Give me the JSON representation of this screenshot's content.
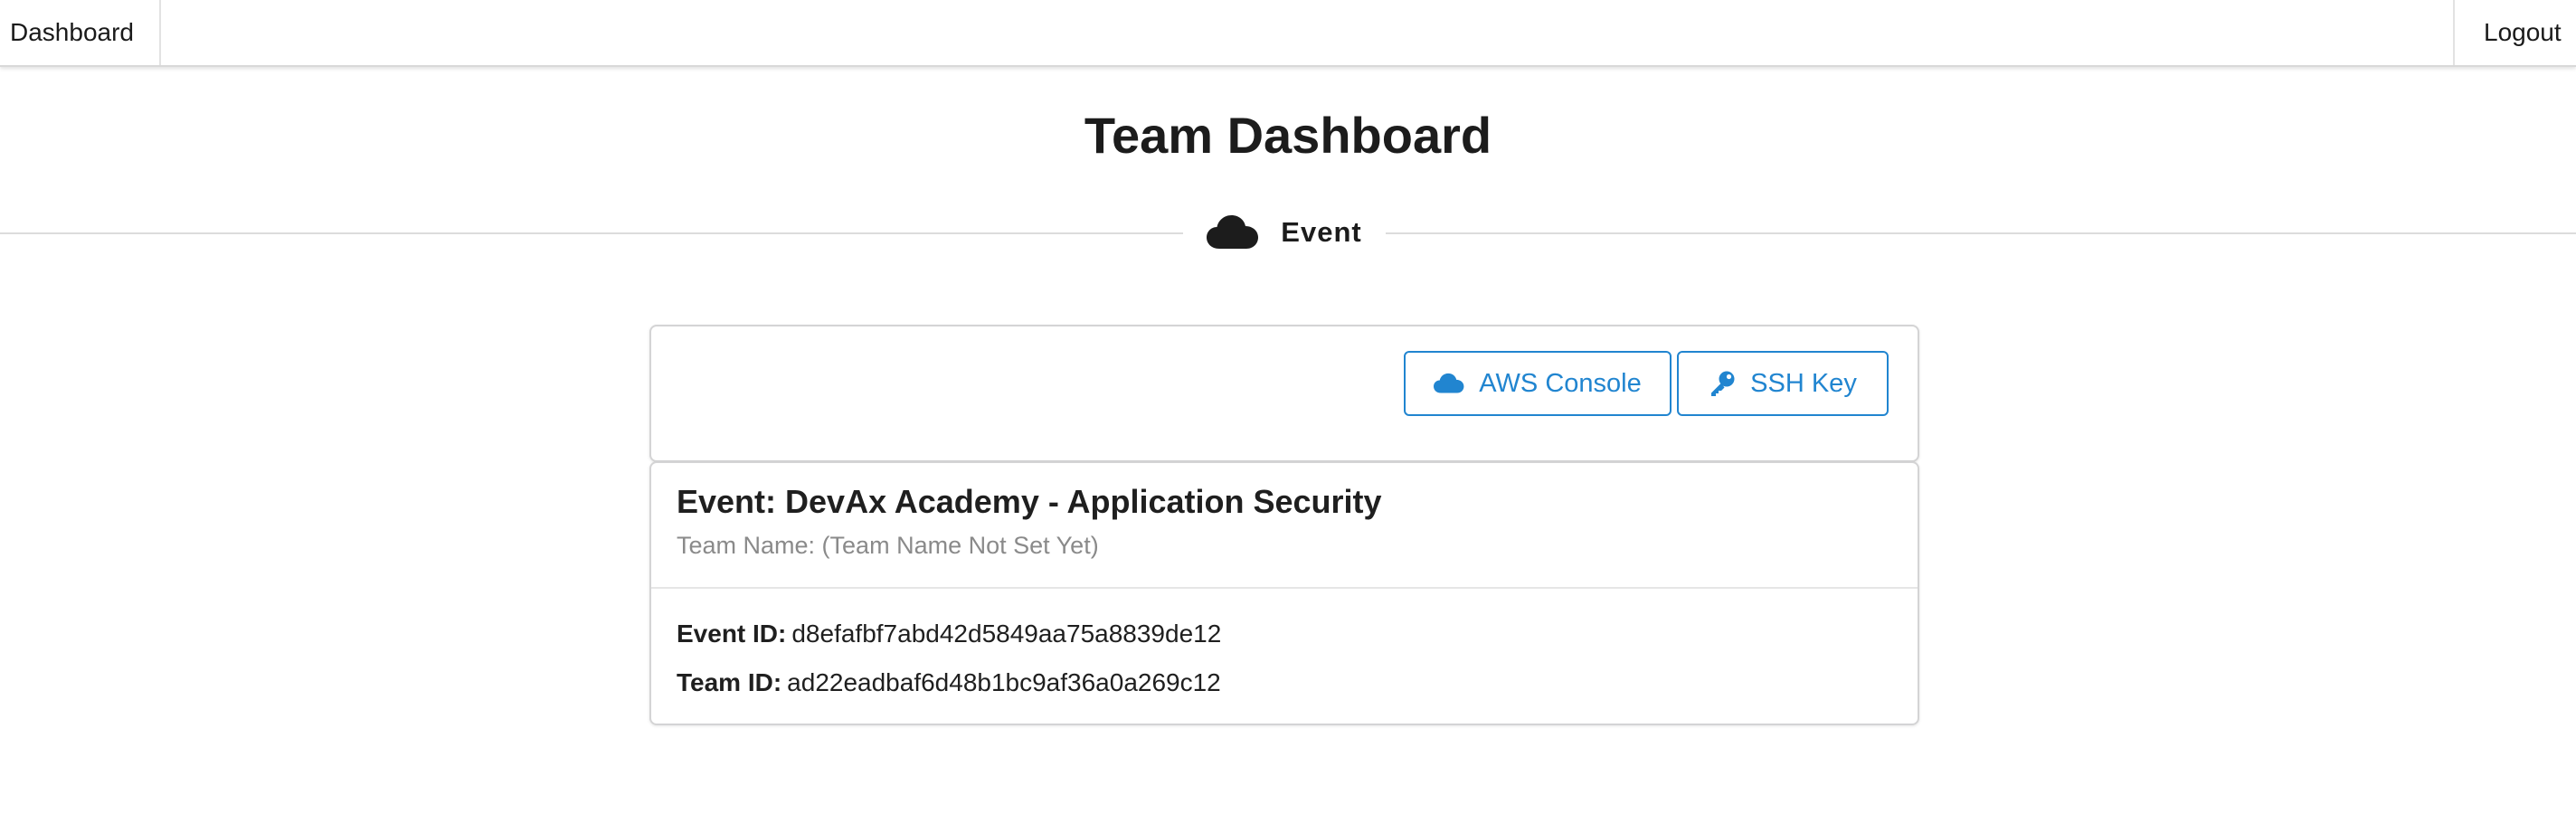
{
  "topbar": {
    "dashboard_label": "Dashboard",
    "logout_label": "Logout"
  },
  "page": {
    "title": "Team Dashboard",
    "section_label": "Event",
    "section_icon": "cloud-icon"
  },
  "actions": {
    "aws_console_label": "AWS Console",
    "aws_console_icon": "cloud-icon",
    "ssh_key_label": "SSH Key",
    "ssh_key_icon": "key-icon"
  },
  "event_card": {
    "title": "Event: DevAx Academy - Application Security",
    "team_name": "Team Name: (Team Name Not Set Yet)",
    "event_id_label": "Event ID:",
    "event_id_value": "d8efafbf7abd42d5849aa75a8839de12",
    "team_id_label": "Team ID:",
    "team_id_value": "ad22eadbaf6d48b1bc9af36a0a269c12"
  },
  "colors": {
    "accent": "#2185d0",
    "text": "#1f1f1f",
    "muted": "#8a8a8a",
    "border": "#d4d4d5"
  }
}
